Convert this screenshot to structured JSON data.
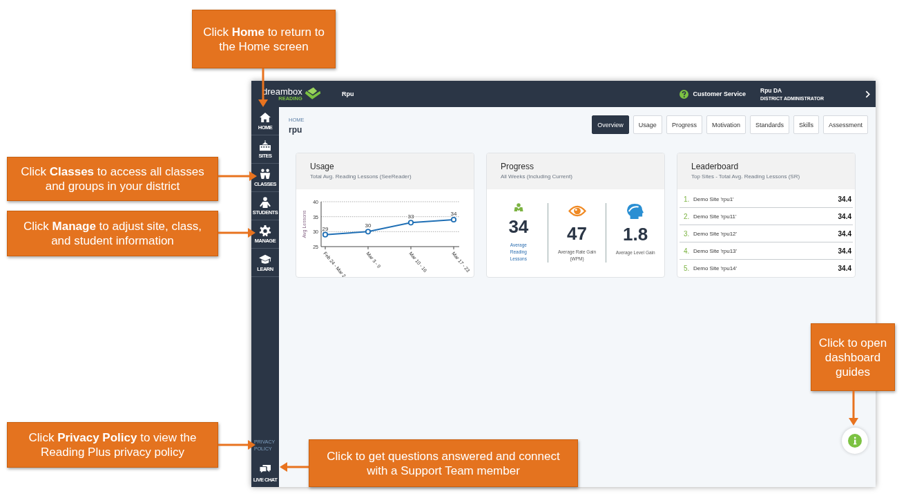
{
  "header": {
    "logo_word": "dreambox",
    "logo_sub": "READING",
    "org": "Rpu",
    "support": "Customer Service",
    "user_name": "Rpu DA",
    "user_role": "DISTRICT ADMINISTRATOR"
  },
  "sidebar": {
    "items": [
      {
        "label": "HOME",
        "kind": "home"
      },
      {
        "label": "SITES",
        "kind": "sites"
      },
      {
        "label": "CLASSES",
        "kind": "classes"
      },
      {
        "label": "STUDENTS",
        "kind": "students"
      },
      {
        "label": "MANAGE",
        "kind": "manage"
      },
      {
        "label": "LEARN",
        "kind": "learn"
      }
    ],
    "privacy_link": "PRIVACY POLICY",
    "live_chat": "LIVE CHAT"
  },
  "breadcrumb": "HOME",
  "page_title": "rpu",
  "tabs": [
    {
      "label": "Overview",
      "selected": true
    },
    {
      "label": "Usage",
      "selected": false
    },
    {
      "label": "Progress",
      "selected": false
    },
    {
      "label": "Motivation",
      "selected": false
    },
    {
      "label": "Standards",
      "selected": false
    },
    {
      "label": "Skills",
      "selected": false
    },
    {
      "label": "Assessment",
      "selected": false
    }
  ],
  "usage": {
    "title": "Usage",
    "subtitle": "Total Avg. Reading Lessons (SeeReader)",
    "chart_data": {
      "type": "line",
      "ylabel": "Avg Lessons",
      "categories": [
        "Feb 24 - Mar 2",
        "Mar 3 - 9",
        "Mar 10 - 16",
        "Mar 17 - 23"
      ],
      "series": [
        {
          "color": "#1f6fb5",
          "marker": "circle",
          "values": [
            29,
            30,
            33,
            34
          ]
        }
      ],
      "ylim": [
        25,
        40
      ],
      "yticks": [
        25,
        30,
        35,
        40
      ],
      "data_labels": true
    }
  },
  "progress": {
    "title": "Progress",
    "subtitle": "All Weeks (Including Current)",
    "stats": [
      {
        "kind": "lessons",
        "value": "34",
        "label": "Average Reading Lessons"
      },
      {
        "kind": "rate",
        "value": "47",
        "label": "Average Rate Gain (WPM)"
      },
      {
        "kind": "level",
        "value": "1.8",
        "label": "Average Level Gain"
      }
    ]
  },
  "leaderboard": {
    "title": "Leaderboard",
    "subtitle": "Top Sites - Total Avg. Reading Lessons (SR)",
    "rows": [
      {
        "rank": "1.",
        "name": "Demo Site 'rpu1'",
        "value": "34.4"
      },
      {
        "rank": "2.",
        "name": "Demo Site 'rpu11'",
        "value": "34.4"
      },
      {
        "rank": "3.",
        "name": "Demo Site 'rpu12'",
        "value": "34.4"
      },
      {
        "rank": "4.",
        "name": "Demo Site 'rpu13'",
        "value": "34.4"
      },
      {
        "rank": "5.",
        "name": "Demo Site 'rpu14'",
        "value": "34.4"
      }
    ]
  },
  "callouts": [
    {
      "text": "Click **Home** to return to the Home screen"
    },
    {
      "text": "Click **Classes** to access all classes and groups in your district"
    },
    {
      "text": "Click **Manage** to adjust site, class, and student information"
    },
    {
      "text": "Click **Privacy Policy** to view the Reading Plus privacy policy"
    },
    {
      "text": "Click to get questions answered  and connect with a Support Team member"
    },
    {
      "text": "Click to open dashboard guides"
    }
  ]
}
